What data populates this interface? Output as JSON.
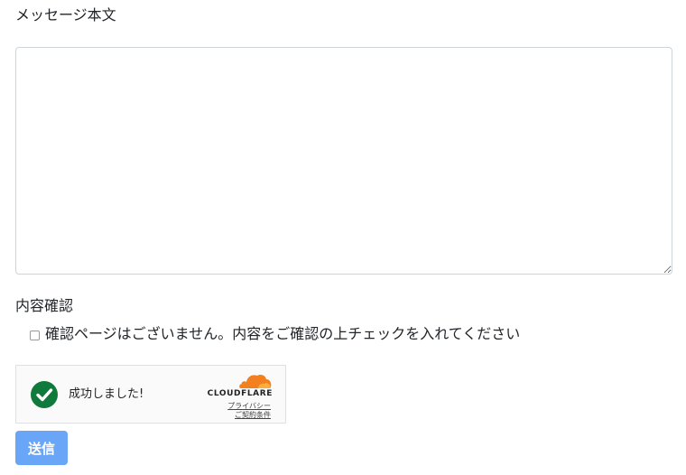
{
  "message": {
    "label": "メッセージ本文",
    "value": ""
  },
  "confirm": {
    "label": "内容確認",
    "checkbox_label": "確認ページはございません。内容をご確認の上チェックを入れてください",
    "checked": false
  },
  "turnstile": {
    "status": "成功しました!",
    "brand": "CLOUDFLARE",
    "privacy_link": "プライバシー",
    "terms_link": "ご契約条件",
    "check_color": "#0f7a3b",
    "cloud_color": "#f38020"
  },
  "submit": {
    "label": "送信",
    "color": "#6aa6f8"
  }
}
